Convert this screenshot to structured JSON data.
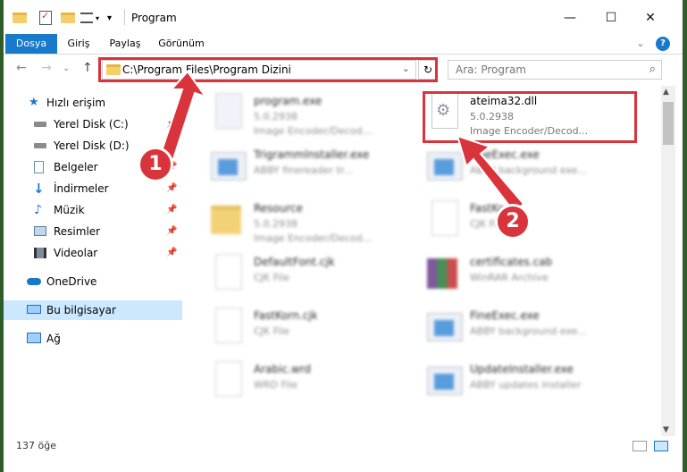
{
  "window": {
    "title": "Program",
    "minimize_glyph": "—",
    "maximize_glyph": "☐",
    "close_glyph": "✕"
  },
  "ribbon": {
    "tabs": [
      "Dosya",
      "Giriş",
      "Paylaş",
      "Görünüm"
    ],
    "expand_glyph": "⌄",
    "help_glyph": "?"
  },
  "address": {
    "path": "C:\\Program Files\\Program Dizini",
    "dropdown_glyph": "⌄",
    "refresh_glyph": "↻"
  },
  "search": {
    "placeholder": "Ara: Program",
    "icon_glyph": "⌕"
  },
  "nav": {
    "back": "←",
    "forward": "→",
    "recent": "⌄",
    "up": "↑"
  },
  "sidebar": {
    "items": [
      {
        "label": "Hızlı erişim"
      },
      {
        "label": "Yerel Disk (C:)"
      },
      {
        "label": "Yerel Disk (D:)"
      },
      {
        "label": "Belgeler"
      },
      {
        "label": "İndirmeler"
      },
      {
        "label": "Müzik"
      },
      {
        "label": "Resimler"
      },
      {
        "label": "Videolar"
      },
      {
        "label": "OneDrive"
      },
      {
        "label": "Bu bilgisayar"
      },
      {
        "label": "Ağ"
      }
    ],
    "pin_glyph": "📌"
  },
  "files": [
    {
      "name": "program.exe",
      "line1": "5.0.2938",
      "line2": "Image Encoder/Decod..."
    },
    {
      "name": "ateima32.dll",
      "line1": "5.0.2938",
      "line2": "Image Encoder/Decod..."
    },
    {
      "name": "Trigrammlnstaller.exe",
      "line1": "ABBY finereader tr..."
    },
    {
      "name": "FineExec.exe",
      "line1": "ABBY background exe..."
    },
    {
      "name": "Resource",
      "line1": "5.0.2938",
      "line2": "Image Encoder/Decod..."
    },
    {
      "name": "FastKo...",
      "line1": "CJK File"
    },
    {
      "name": "DefaultFont.cjk",
      "line1": "CJK File"
    },
    {
      "name": "certificates.cab",
      "line1": "WinRAR Archive"
    },
    {
      "name": "FastKorn.cjk",
      "line1": "CJK File"
    },
    {
      "name": "FineExec.exe",
      "line1": "ABBY background exe..."
    },
    {
      "name": "Arabic.wrd",
      "line1": "WRD File"
    },
    {
      "name": "UpdateInstaller.exe",
      "line1": "ABBY updates installer"
    }
  ],
  "status": {
    "count": "137 öğe"
  },
  "callouts": {
    "one": "1",
    "two": "2"
  },
  "colors": {
    "highlight": "#d9343b",
    "accent": "#1979ca",
    "selected": "#cce8ff"
  }
}
